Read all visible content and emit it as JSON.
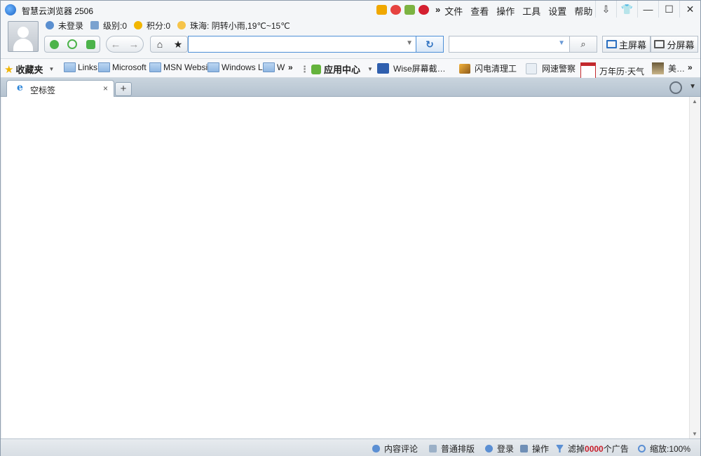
{
  "window": {
    "title": "智慧云浏览器 2506",
    "menu": [
      "文件",
      "查看",
      "操作",
      "工具",
      "设置",
      "帮助"
    ],
    "menu_overflow": "»",
    "controls": {
      "download": "⇩",
      "skin": "👕",
      "minimize": "—",
      "maximize": "☐",
      "close": "✕"
    }
  },
  "user": {
    "status": "未登录",
    "level": "级别:0",
    "points": "积分:0",
    "weather": "珠海: 阴转小雨,19℃~15℃"
  },
  "nav": {
    "address_value": "",
    "search_value": "",
    "main_screen": "主屏幕",
    "split_screen": "分屏幕"
  },
  "favorites": {
    "title": "收藏夹",
    "items": [
      "Links",
      "Microsoft",
      "MSN Websit",
      "Windows Li",
      "W"
    ],
    "overflow": "»",
    "app_center": "应用中心",
    "apps": [
      "Wise屏幕截…",
      "闪电清理工",
      "网速警察",
      "万年历·天气",
      "美…"
    ],
    "app_overflow": "»"
  },
  "tabs": {
    "items": [
      {
        "label": "空标签"
      }
    ],
    "new_tab": "+",
    "close": "×"
  },
  "status": {
    "comments": "内容评论",
    "layout": "普通排版",
    "login": "登录",
    "operate": "操作",
    "ad_prefix": "滤掉",
    "ad_count": "0000",
    "ad_suffix": "个广告",
    "zoom": "缩放:100%"
  },
  "colors": {
    "accent": "#2a6fc0",
    "address_border": "#4d8fd6",
    "ad_count": "#c8202c"
  }
}
